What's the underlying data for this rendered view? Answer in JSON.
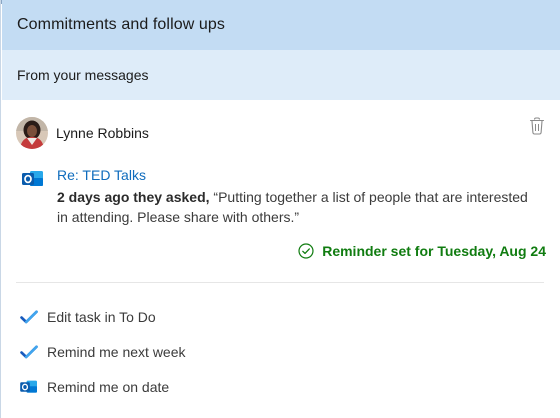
{
  "header": {
    "title": "Commitments and follow ups"
  },
  "subheader": {
    "title": "From your messages"
  },
  "card": {
    "sender": "Lynne Robbins",
    "avatar_icon": "person-photo",
    "delete_icon": "trash-icon",
    "app_icon": "outlook-icon",
    "subject": "Re: TED Talks",
    "message_prefix": "2 days ago they asked,",
    "message_quote": " “Putting together a list of people that are interested in attending. Please share with others.”",
    "reminder": "Reminder set for Tuesday, Aug 24",
    "reminder_icon": "check-circle-icon"
  },
  "actions": [
    {
      "label": "Edit task in To Do",
      "icon": "todo-check-icon"
    },
    {
      "label": "Remind me next week",
      "icon": "todo-check-icon"
    },
    {
      "label": "Remind me on date",
      "icon": "outlook-icon"
    }
  ],
  "colors": {
    "header_bg": "#c3dcf3",
    "subheader_bg": "#deecf9",
    "link": "#0f6cbd",
    "success": "#107c10",
    "todo_dark": "#185abd",
    "todo_light": "#41a5ee",
    "outlook_blue": "#0078d4"
  }
}
